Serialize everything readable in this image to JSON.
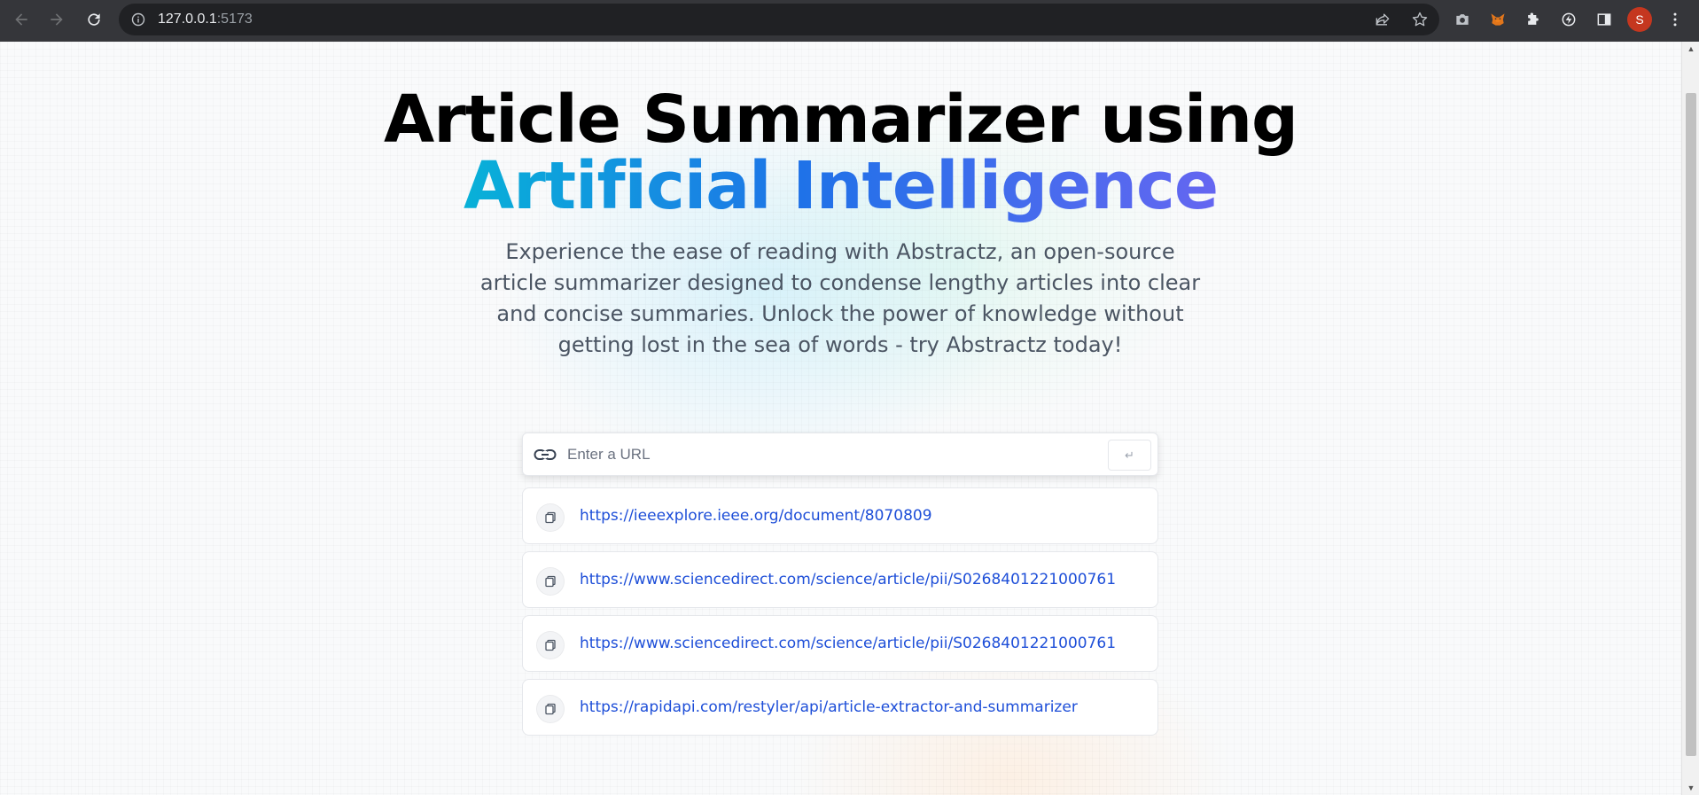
{
  "browser": {
    "url_host": "127.0.0.1",
    "url_port": ":5173",
    "avatar_initial": "S",
    "icons": [
      "back-arrow-icon",
      "forward-arrow-icon",
      "reload-icon",
      "site-info-icon",
      "share-icon",
      "bookmark-star-icon",
      "camera-extension-icon",
      "metamask-fox-icon",
      "puzzle-extensions-icon",
      "extension-bolt-icon",
      "side-panel-icon",
      "kebab-menu-icon"
    ]
  },
  "hero": {
    "title_line1": "Article Summarizer using",
    "title_line2": "Artificial Intelligence",
    "description": "Experience the ease of reading with Abstractz, an open-source article summarizer designed to condense lengthy articles into clear and concise summaries. Unlock the power of knowledge without getting lost in the sea of words - try Abstractz today!"
  },
  "search": {
    "placeholder": "Enter a URL",
    "value": "",
    "submit_label": "↵"
  },
  "history": [
    {
      "url": "https://ieeexplore.ieee.org/document/8070809"
    },
    {
      "url": "https://www.sciencedirect.com/science/article/pii/S0268401221000761"
    },
    {
      "url": "https://www.sciencedirect.com/science/article/pii/S0268401221000761"
    },
    {
      "url": "https://rapidapi.com/restyler/api/article-extractor-and-summarizer"
    }
  ],
  "colors": {
    "gradient_start": "#08b1d8",
    "gradient_mid": "#1f72e8",
    "gradient_end": "#6566f1",
    "link": "#1d4ed8",
    "avatar": "#c5371f"
  }
}
